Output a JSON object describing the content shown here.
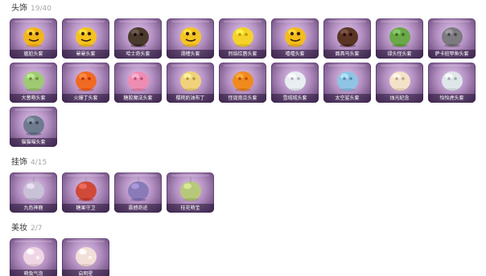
{
  "sections": [
    {
      "title": "头饰",
      "count": "19/40",
      "items": [
        {
          "label": "尴尬头套",
          "icon": "awkward-emoji-head-icon",
          "color": "#f2b51b"
        },
        {
          "label": "晕晕头套",
          "icon": "dizzy-emoji-head-icon",
          "color": "#f4c21f"
        },
        {
          "label": "哈士奇头套",
          "icon": "husky-head-icon",
          "color": "#4a3a2e"
        },
        {
          "label": "滑稽头套",
          "icon": "grin-emoji-head-icon",
          "color": "#f5c424"
        },
        {
          "label": "烈焰红唇头套",
          "icon": "yellow-creature-sunglasses-head-icon",
          "color": "#f4d22a"
        },
        {
          "label": "嘻嘻头套",
          "icon": "laughing-emoji-head-icon",
          "color": "#f3bb1d"
        },
        {
          "label": "面具马头套",
          "icon": "horse-head-icon",
          "color": "#5a3424"
        },
        {
          "label": "绿头怪头套",
          "icon": "green-monster-head-icon",
          "color": "#6aa84a"
        },
        {
          "label": "萨卡班甲鱼头套",
          "icon": "fish-head-icon",
          "color": "#7d7a80"
        },
        {
          "label": "大葱萌头套",
          "icon": "green-onion-head-icon",
          "color": "#9fc973"
        },
        {
          "label": "火爆丁头套",
          "icon": "fire-spirit-head-icon",
          "color": "#f06a22"
        },
        {
          "label": "糖胶魔法头套",
          "icon": "pink-blob-head-icon",
          "color": "#ef8cb2"
        },
        {
          "label": "樱桃奶油布丁",
          "icon": "pudding-head-icon",
          "color": "#f1d27a"
        },
        {
          "label": "怪诞南瓜头套",
          "icon": "pumpkin-head-icon",
          "color": "#f08a1e"
        },
        {
          "label": "雪绒绒头套",
          "icon": "snowman-head-icon",
          "color": "#e8eef2"
        },
        {
          "label": "太空鲨头套",
          "icon": "shark-head-icon",
          "color": "#8fc4e4"
        },
        {
          "label": "烛光纪念",
          "icon": "candle-head-icon",
          "color": "#f4e2c8"
        },
        {
          "label": "怡怡虎头套",
          "icon": "cloud-tiger-head-icon",
          "color": "#dfe6ea"
        },
        {
          "label": "猫猫喵头套",
          "icon": "gray-cat-head-icon",
          "color": "#6e7a8e"
        }
      ]
    },
    {
      "title": "挂饰",
      "count": "4/15",
      "items": [
        {
          "label": "九色神鹿",
          "icon": "deer-charm-icon",
          "color": "#c9c1d6"
        },
        {
          "label": "糖果守卫",
          "icon": "candy-guard-charm-icon",
          "color": "#d04a3a"
        },
        {
          "label": "震撼奇迹",
          "icon": "wonder-charm-icon",
          "color": "#8a7ab8"
        },
        {
          "label": "桂花萌宝",
          "icon": "osmanthus-charm-icon",
          "color": "#b8c87a"
        }
      ]
    },
    {
      "title": "美妆",
      "count": "2/7",
      "items": [
        {
          "label": "萌兔气泡",
          "icon": "bunny-bubble-icon",
          "color": "#f0d6e4"
        },
        {
          "label": "启明星",
          "icon": "morning-star-icon",
          "color": "#f2e0d8"
        }
      ]
    }
  ]
}
